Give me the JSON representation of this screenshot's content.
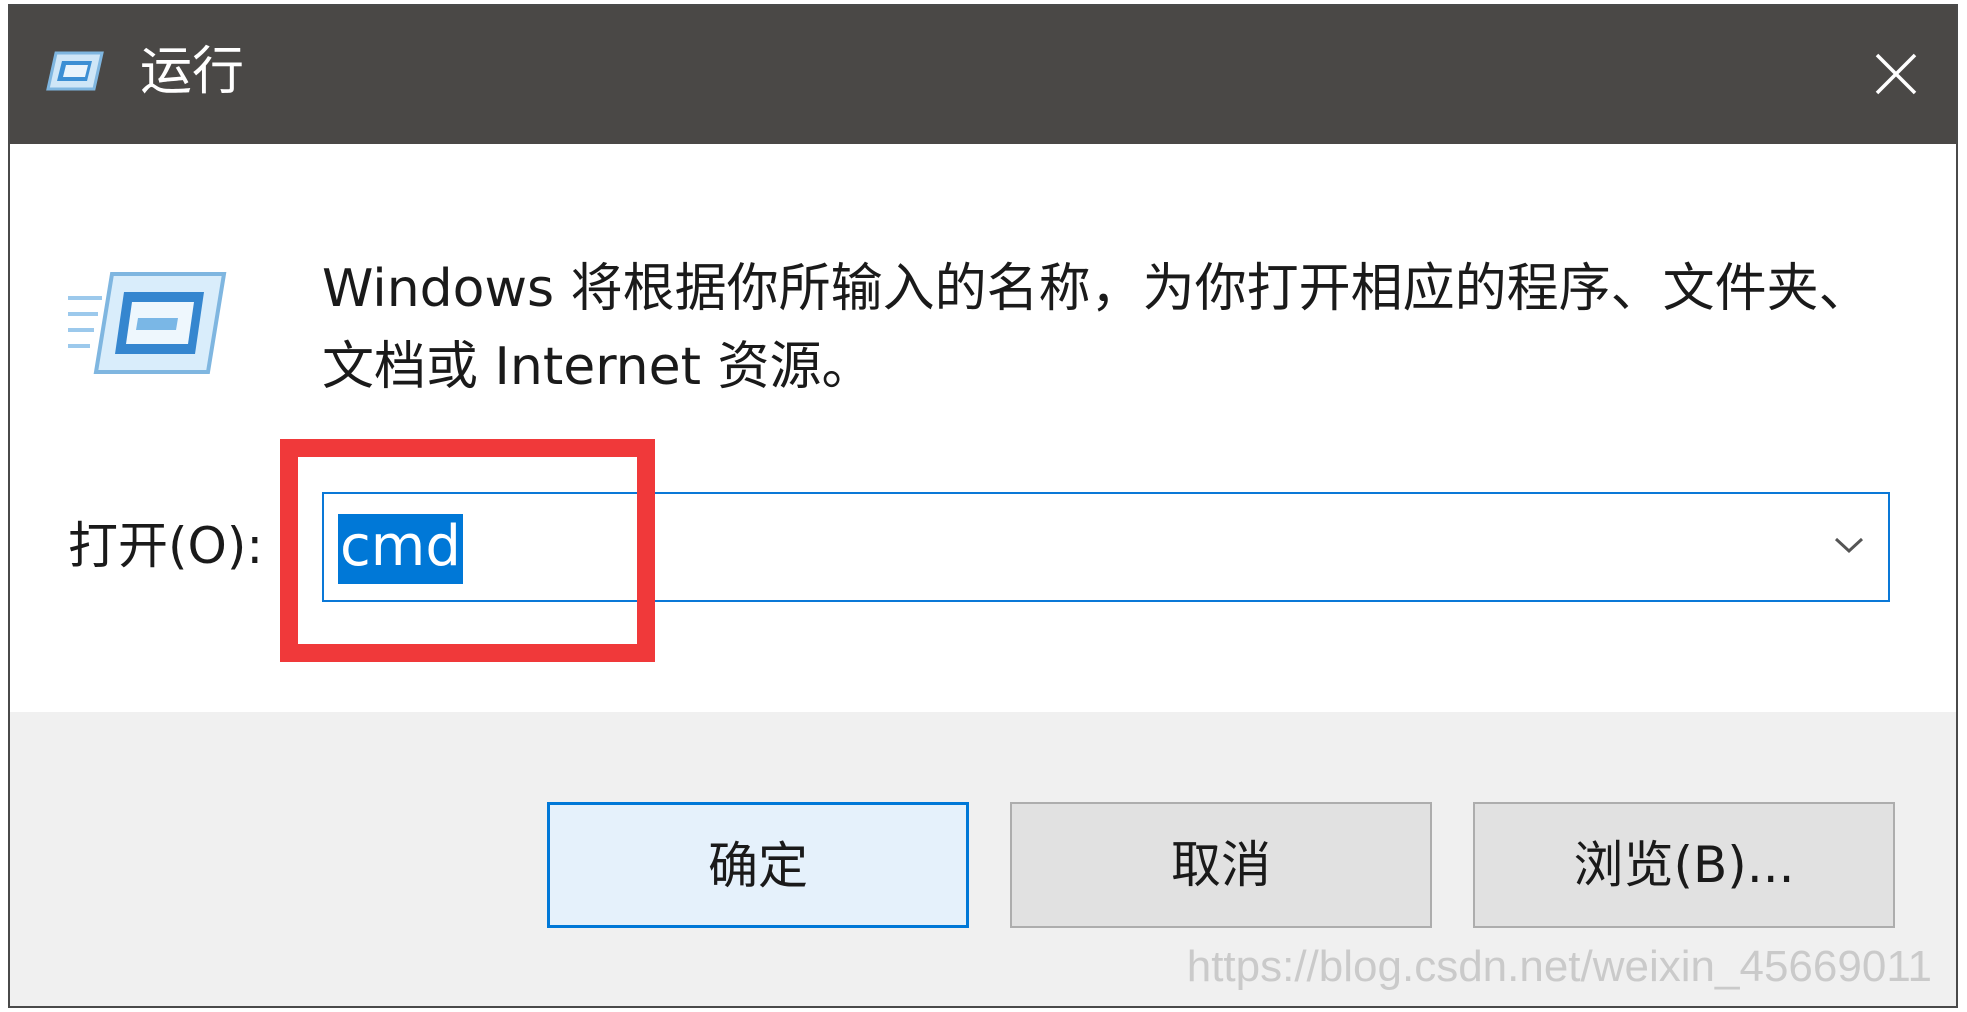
{
  "window": {
    "title": "运行",
    "title_icon": "run-dialog-icon",
    "close_icon": "close-icon"
  },
  "content": {
    "description": "Windows 将根据你所输入的名称，为你打开相应的程序、文件夹、文档或 Internet 资源。",
    "open_label": "打开(O):",
    "open_value": "cmd",
    "dropdown_icon": "chevron-down-icon",
    "highlight_color": "#f0393a"
  },
  "buttons": {
    "ok": "确定",
    "cancel": "取消",
    "browse": "浏览(B)..."
  },
  "watermark": "https://blog.csdn.net/weixin_45669011",
  "colors": {
    "titlebar": "#4a4846",
    "accent": "#0078d7",
    "footer": "#f0f0f0"
  }
}
